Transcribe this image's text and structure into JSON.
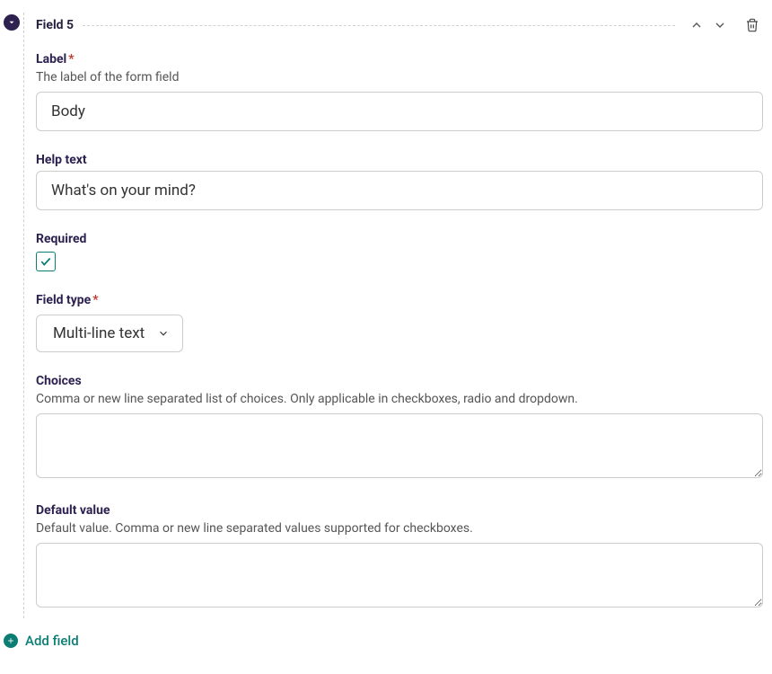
{
  "field": {
    "title": "Field 5",
    "label": {
      "label": "Label",
      "help": "The label of the form field",
      "value": "Body"
    },
    "helptext": {
      "label": "Help text",
      "value": "What's on your mind?"
    },
    "required": {
      "label": "Required",
      "checked": true
    },
    "fieldtype": {
      "label": "Field type",
      "value": "Multi-line text"
    },
    "choices": {
      "label": "Choices",
      "help": "Comma or new line separated list of choices. Only applicable in checkboxes, radio and dropdown.",
      "value": ""
    },
    "defaultvalue": {
      "label": "Default value",
      "help": "Default value. Comma or new line separated values supported for checkboxes.",
      "value": ""
    }
  },
  "footer": {
    "add_field": "Add field"
  }
}
